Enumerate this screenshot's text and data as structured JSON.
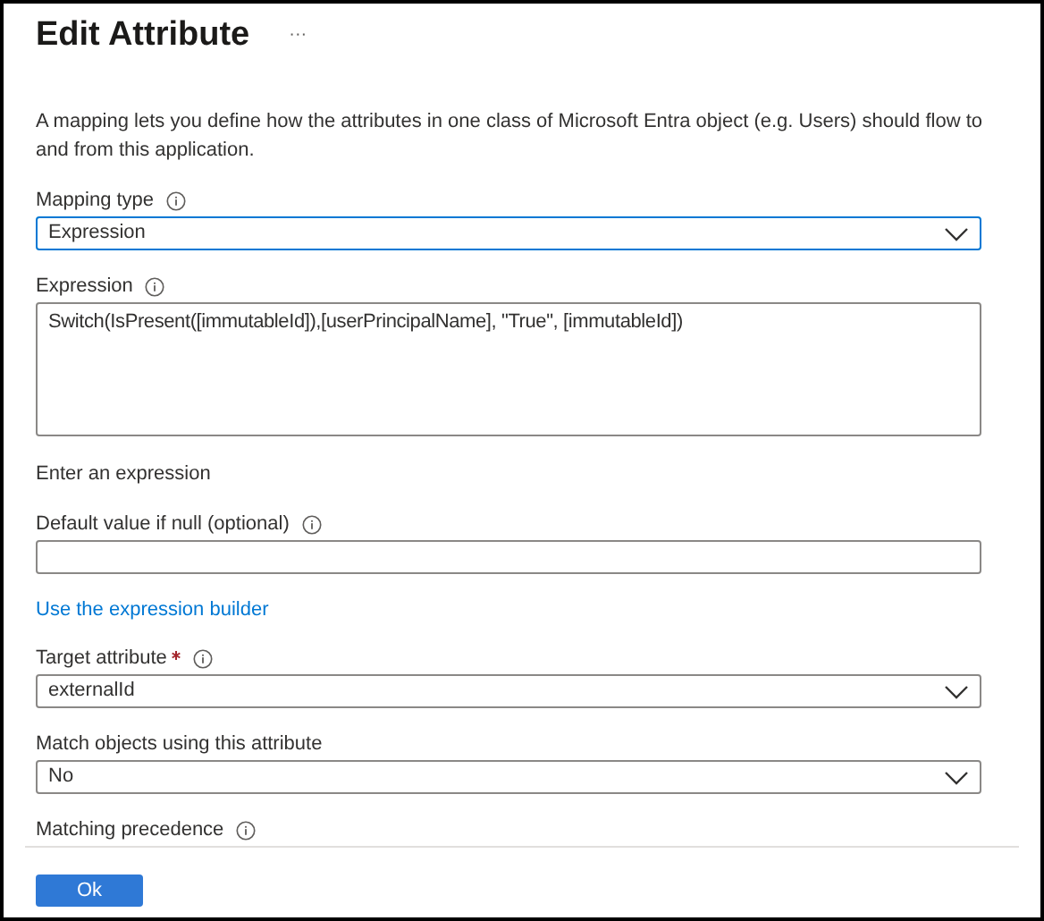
{
  "title": "Edit Attribute",
  "more": "···",
  "description": "A mapping lets you define how the attributes in one class of Microsoft Entra object (e.g. Users) should flow to and from this application.",
  "fields": [
    {
      "kind": "select",
      "label": "Mapping type",
      "info": true,
      "required": false,
      "value": "Expression",
      "focused": true
    },
    {
      "kind": "textarea",
      "label": "Expression",
      "info": true,
      "required": false,
      "value": "Switch(IsPresent([immutableId]),[userPrincipalName], \"True\", [immutableId])",
      "focused": false
    },
    {
      "kind": "hint",
      "label": "Enter an expression"
    },
    {
      "kind": "input",
      "label": "Default value if null (optional)",
      "info": true,
      "required": false,
      "focused": false
    },
    {
      "kind": "link",
      "label": "Use the expression builder"
    },
    {
      "kind": "select",
      "label": "Target attribute",
      "info": true,
      "required": true,
      "value": "externalId",
      "focused": false
    },
    {
      "kind": "select",
      "label": "Match objects using this attribute",
      "info": false,
      "required": false,
      "value": "No",
      "focused": false
    },
    {
      "kind": "heading",
      "label": "Matching precedence",
      "info": true,
      "required": false
    }
  ],
  "ok_button": "Ok"
}
